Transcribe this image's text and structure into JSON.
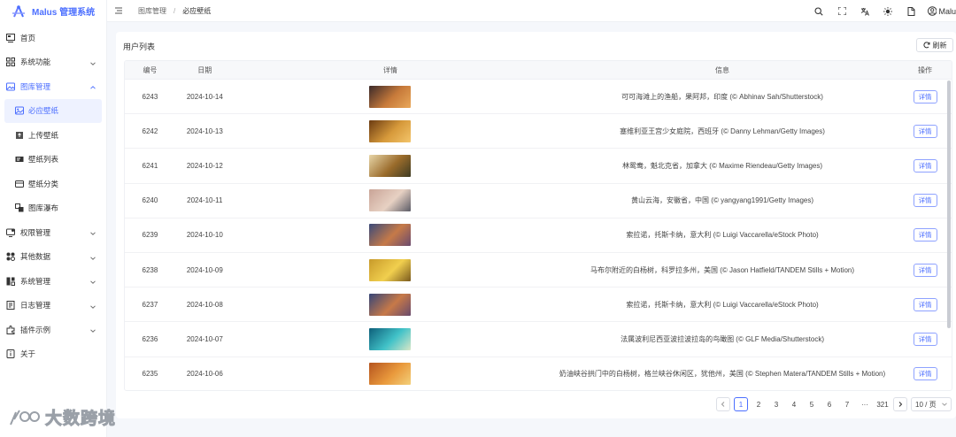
{
  "app": {
    "title": "Malus 管理系统"
  },
  "sidebar": {
    "items": [
      {
        "label": "首页",
        "icon": "dashboard-icon",
        "type": "top"
      },
      {
        "label": "系统功能",
        "icon": "grid-icon",
        "type": "top",
        "chevron": "down"
      },
      {
        "label": "图库管理",
        "icon": "image-icon",
        "type": "top",
        "chevron": "up",
        "open": true
      },
      {
        "label": "必应壁纸",
        "icon": "picture-icon",
        "type": "sub",
        "active": true
      },
      {
        "label": "上传壁纸",
        "icon": "upload-icon",
        "type": "sub"
      },
      {
        "label": "壁纸列表",
        "icon": "list-icon",
        "type": "sub"
      },
      {
        "label": "壁纸分类",
        "icon": "category-icon",
        "type": "sub"
      },
      {
        "label": "图库瀑布",
        "icon": "waterfall-icon",
        "type": "sub"
      },
      {
        "label": "权限管理",
        "icon": "permission-icon",
        "type": "top",
        "chevron": "down"
      },
      {
        "label": "其他数据",
        "icon": "data-icon",
        "type": "top",
        "chevron": "down"
      },
      {
        "label": "系统管理",
        "icon": "system-icon",
        "type": "top",
        "chevron": "down"
      },
      {
        "label": "日志管理",
        "icon": "log-icon",
        "type": "top",
        "chevron": "down"
      },
      {
        "label": "插件示例",
        "icon": "plugin-icon",
        "type": "top",
        "chevron": "down"
      },
      {
        "label": "关于",
        "icon": "about-icon",
        "type": "top"
      }
    ]
  },
  "header": {
    "breadcrumb": [
      "图库管理",
      "必应壁纸"
    ],
    "user": "Malu",
    "icons": [
      "search-icon",
      "fullscreen-icon",
      "translate-icon",
      "theme-sun-icon",
      "document-icon",
      "user-icon"
    ]
  },
  "card": {
    "title": "用户列表",
    "refresh_label": "刷新"
  },
  "table": {
    "columns": [
      "编号",
      "日期",
      "详情",
      "信息",
      "操作"
    ],
    "detail_label": "详情",
    "rows": [
      {
        "id": "6243",
        "date": "2024-10-14",
        "info": "可可海滩上的渔船，果阿邦，印度 (© Abhinav Sah/Shutterstock)",
        "thumb": [
          "#3b2a2a",
          "#c77a3a",
          "#e9a85a"
        ]
      },
      {
        "id": "6242",
        "date": "2024-10-13",
        "info": "塞维利亚王宫少女庭院，西班牙 (© Danny Lehman/Getty Images)",
        "thumb": [
          "#6b3b12",
          "#d79a3b",
          "#f3c56b"
        ]
      },
      {
        "id": "6241",
        "date": "2024-10-12",
        "info": "林鸳鸯，魁北克省，加拿大 (© Maxime Riendeau/Getty Images)",
        "thumb": [
          "#e8d6a8",
          "#9a6b2b",
          "#3d3b22"
        ]
      },
      {
        "id": "6240",
        "date": "2024-10-11",
        "info": "黄山云海，安徽省，中国 (© yangyang1991/Getty Images)",
        "thumb": [
          "#c9a497",
          "#e7d1c3",
          "#5b5b66"
        ]
      },
      {
        "id": "6239",
        "date": "2024-10-10",
        "info": "索拉诺，托斯卡纳，意大利 (© Luigi Vaccarella/eStock Photo)",
        "thumb": [
          "#3a4a7a",
          "#c67a48",
          "#6a4a6e"
        ]
      },
      {
        "id": "6238",
        "date": "2024-10-09",
        "info": "马布尔附近的白杨树，科罗拉多州，美国 (© Jason Hatfield/TANDEM Stills + Motion)",
        "thumb": [
          "#c89a2a",
          "#f1cf4e",
          "#7a5a1e"
        ]
      },
      {
        "id": "6237",
        "date": "2024-10-08",
        "info": "索拉诺，托斯卡纳，意大利 (© Luigi Vaccarella/eStock Photo)",
        "thumb": [
          "#354578",
          "#c77948",
          "#684a6c"
        ]
      },
      {
        "id": "6236",
        "date": "2024-10-07",
        "info": "法属波利尼西亚波拉波拉岛的鸟瞰图 (© GLF Media/Shutterstock)",
        "thumb": [
          "#0e5f7a",
          "#41c2c8",
          "#d9e7c7"
        ]
      },
      {
        "id": "6235",
        "date": "2024-10-06",
        "info": "奶油峡谷拱门中的白杨树，格兰峡谷休闲区，犹他州，美国 (© Stephen Matera/TANDEM Stills + Motion)",
        "thumb": [
          "#b5541e",
          "#e9993c",
          "#f3d07a"
        ]
      }
    ]
  },
  "pagination": {
    "pages": [
      "1",
      "2",
      "3",
      "4",
      "5",
      "6",
      "7",
      "···",
      "321"
    ],
    "current": "1",
    "page_size": "10 / 页"
  },
  "watermark": {
    "text": "大数跨境"
  },
  "colors": {
    "accent": "#4c6fff",
    "bg": "#f5f7fb"
  }
}
